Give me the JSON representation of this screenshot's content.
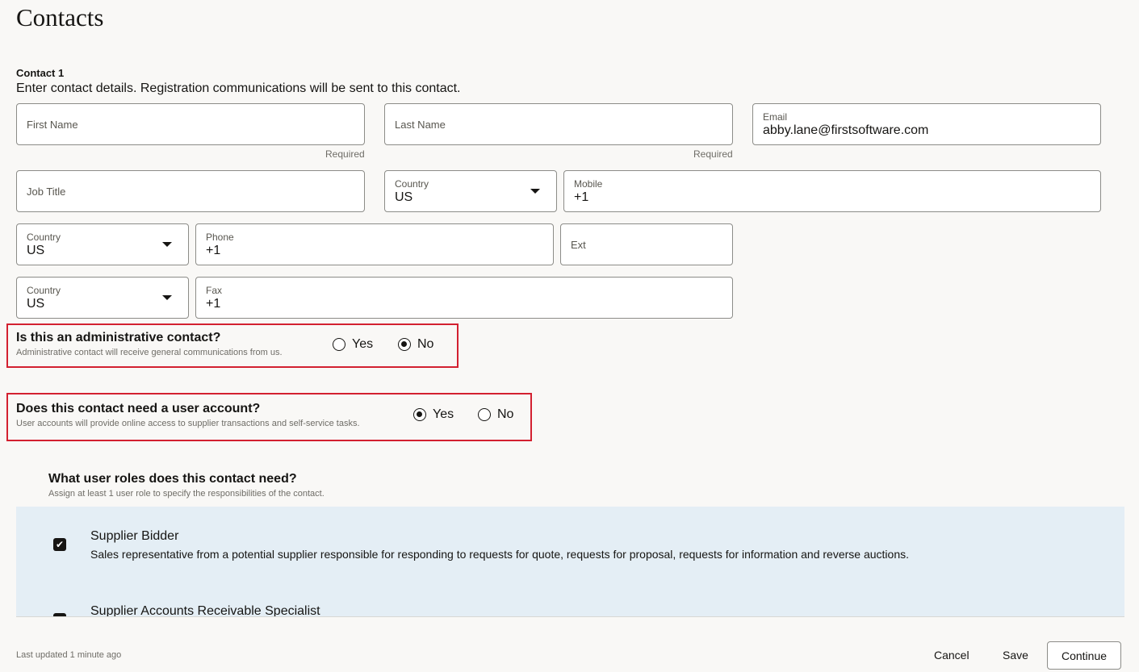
{
  "page": {
    "title": "Contacts"
  },
  "contact": {
    "heading": "Contact 1",
    "description": "Enter contact details. Registration communications will be sent to this contact.",
    "first_name": {
      "label": "First Name",
      "value": "",
      "hint": "Required"
    },
    "last_name": {
      "label": "Last Name",
      "value": "",
      "hint": "Required"
    },
    "email": {
      "label": "Email",
      "value": "abby.lane@firstsoftware.com"
    },
    "job_title": {
      "label": "Job Title",
      "value": ""
    },
    "mobile_country": {
      "label": "Country",
      "value": "US"
    },
    "mobile": {
      "label": "Mobile",
      "value": "+1"
    },
    "phone_country": {
      "label": "Country",
      "value": "US"
    },
    "phone": {
      "label": "Phone",
      "value": "+1"
    },
    "ext": {
      "label": "Ext",
      "value": ""
    },
    "fax_country": {
      "label": "Country",
      "value": "US"
    },
    "fax": {
      "label": "Fax",
      "value": "+1"
    }
  },
  "admin_question": {
    "title": "Is this an administrative contact?",
    "subtitle": "Administrative contact will receive general communications from us.",
    "options": [
      "Yes",
      "No"
    ],
    "selected": "No"
  },
  "account_question": {
    "title": "Does this contact need a user account?",
    "subtitle": "User accounts will provide online access to supplier transactions and self-service tasks.",
    "options": [
      "Yes",
      "No"
    ],
    "selected": "Yes"
  },
  "roles": {
    "title": "What user roles does this contact need?",
    "subtitle": "Assign at least 1 user role to specify the responsibilities of the contact.",
    "items": [
      {
        "name": "Supplier Bidder",
        "description": "Sales representative from a potential supplier responsible for responding to requests for quote, requests for proposal, requests for information and reverse auctions.",
        "checked": true
      },
      {
        "name": "Supplier Accounts Receivable Specialist",
        "description": "",
        "checked": true
      }
    ]
  },
  "footer": {
    "last_updated": "Last updated 1 minute ago",
    "cancel_label": "Cancel",
    "save_label": "Save",
    "continue_label": "Continue"
  },
  "colors": {
    "highlight_border": "#d32030",
    "roles_panel_bg": "#e4eef5",
    "page_bg": "#f9f8f6"
  }
}
